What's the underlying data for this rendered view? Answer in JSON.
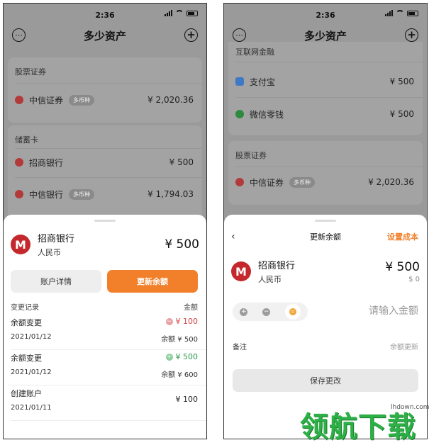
{
  "status_bar": {
    "time": "2:36"
  },
  "header": {
    "title": "多少资产"
  },
  "left": {
    "stocks": {
      "title": "股票证券",
      "items": [
        {
          "name": "中信证券",
          "tag": "多币种",
          "amount": "¥ 2,020.36"
        }
      ]
    },
    "savings": {
      "title": "储蓄卡",
      "items": [
        {
          "name": "招商银行",
          "amount": "¥ 500"
        },
        {
          "name": "中信银行",
          "tag": "多币种",
          "amount": "¥ 1,794.03"
        }
      ]
    },
    "sheet": {
      "bank": {
        "name": "招商银行",
        "currency": "人民币",
        "amount": "¥ 500"
      },
      "detail_button": "账户详情",
      "update_button": "更新余额",
      "records_label": "变更记录",
      "amount_label": "金额",
      "records": [
        {
          "title": "余额变更",
          "date": "2021/01/12",
          "change": "¥ 100",
          "sign": "-",
          "balance": "余额 ¥ 500"
        },
        {
          "title": "余额变更",
          "date": "2021/01/12",
          "change": "¥ 500",
          "sign": "+",
          "balance": "余额 ¥ 600"
        },
        {
          "title": "创建账户",
          "date": "2021/01/11",
          "change": "¥ 100",
          "sign": "",
          "balance": ""
        }
      ]
    }
  },
  "right": {
    "internet": {
      "title": "互联网金融",
      "items": [
        {
          "name": "支付宝",
          "amount": "¥ 500"
        },
        {
          "name": "微信零钱",
          "amount": "¥ 500"
        }
      ]
    },
    "stocks": {
      "title": "股票证券",
      "items": [
        {
          "name": "中信证券",
          "tag": "多币种",
          "amount": "¥ 2,020.36"
        }
      ]
    },
    "sheet": {
      "back": "‹",
      "title": "更新余额",
      "set_cost": "设置成本",
      "bank": {
        "name": "招商银行",
        "currency": "人民币",
        "amount": "¥ 500",
        "sub": "$ 0"
      },
      "amount_placeholder": "请输入金额",
      "note_label": "备注",
      "note_placeholder": "余额更新",
      "save_button": "保存更改"
    }
  },
  "watermark": {
    "text": "领航下载",
    "url": "lhdown.com"
  },
  "colors": {
    "accent": "#f2802b",
    "bank_red": "#c4282d",
    "decrease": "#d04444",
    "increase": "#2e9a4c"
  }
}
